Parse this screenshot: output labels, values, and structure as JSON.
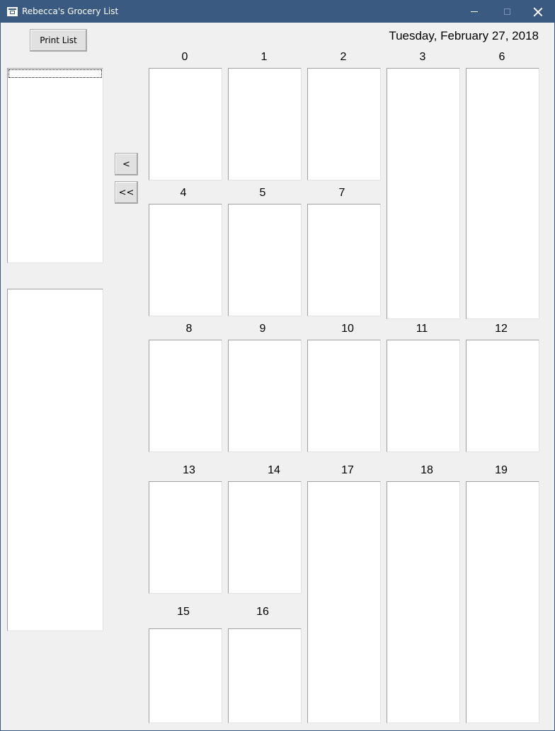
{
  "window": {
    "title": "Rebecca's Grocery List",
    "controls": {
      "minimize": "minimize",
      "maximize": "maximize",
      "close": "close"
    }
  },
  "toolbar": {
    "print_label": "Print List",
    "move_one_label": "<",
    "move_all_label": "<<"
  },
  "header": {
    "date": "Tuesday, February 27, 2018"
  },
  "aisles": {
    "a0": "0",
    "a1": "1",
    "a2": "2",
    "a3": "3",
    "a4": "4",
    "a5": "5",
    "a6": "6",
    "a7": "7",
    "a8": "8",
    "a9": "9",
    "a10": "10",
    "a11": "11",
    "a12": "12",
    "a13": "13",
    "a14": "14",
    "a15": "15",
    "a16": "16",
    "a17": "17",
    "a18": "18",
    "a19": "19"
  },
  "colors": {
    "titlebar": "#3b5a82",
    "window_bg": "#f0f0f0",
    "list_bg": "#ffffff"
  }
}
